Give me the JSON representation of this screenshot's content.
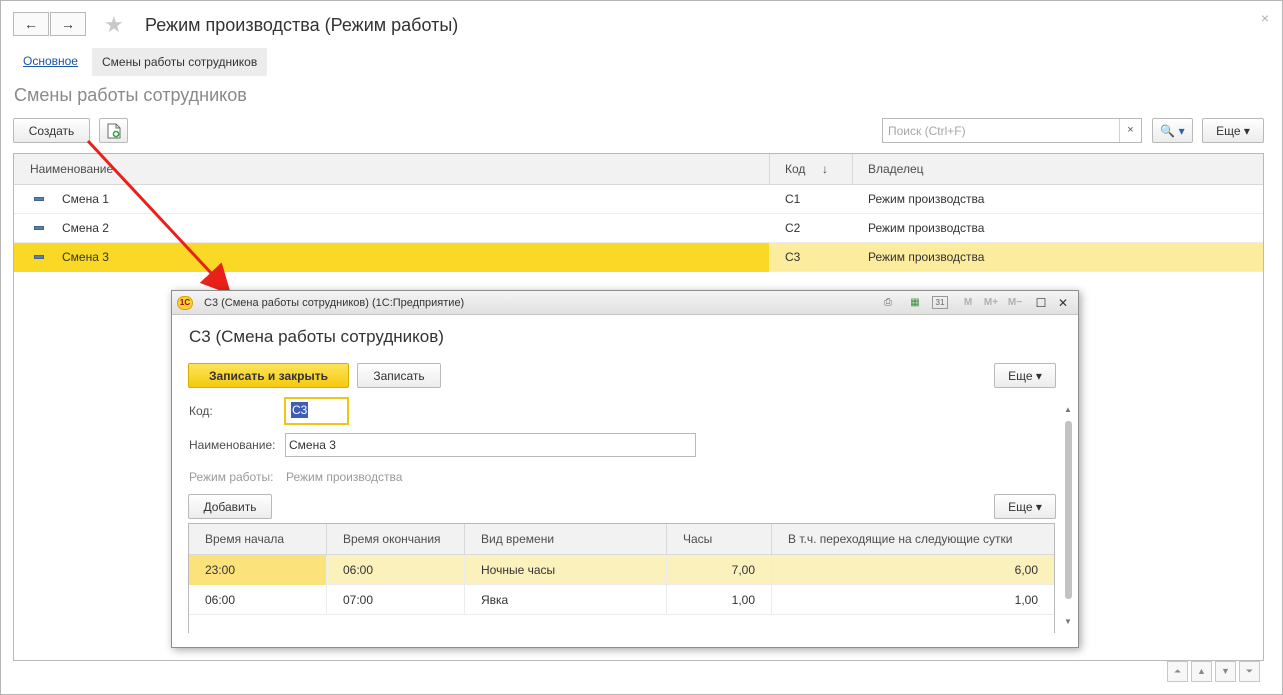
{
  "window": {
    "title": "Режим производства (Режим работы)",
    "back_glyph": "←",
    "forward_glyph": "→",
    "star_glyph": "★",
    "close_glyph": "×"
  },
  "tabs": {
    "main": "Основное",
    "shifts": "Смены работы сотрудников"
  },
  "list": {
    "title": "Смены работы сотрудников",
    "create_label": "Создать",
    "search_placeholder": "Поиск (Ctrl+F)",
    "search_clear": "×",
    "search_btn": "🔍 ▾",
    "more_label": "Еще ▾",
    "columns": {
      "name": "Наименование",
      "code": "Код",
      "code_sort": "↓",
      "owner": "Владелец"
    },
    "rows": [
      {
        "name": "Смена 1",
        "code": "С1",
        "owner": "Режим производства"
      },
      {
        "name": "Смена 2",
        "code": "С2",
        "owner": "Режим производства"
      },
      {
        "name": "Смена 3",
        "code": "С3",
        "owner": "Режим производства"
      }
    ],
    "pager": [
      "⏶",
      "▲",
      "▼",
      "⏷"
    ]
  },
  "dialog": {
    "titlebar": "С3 (Смена работы сотрудников)  (1С:Предприятие)",
    "logo": "1С",
    "controls": {
      "print": "⎙",
      "calc": "▦",
      "calendar": "31",
      "m": "M",
      "mplus": "M+",
      "mminus": "M−",
      "maximize": "☐",
      "close": "✕"
    },
    "heading": "С3 (Смена работы сотрудников)",
    "save_close_label": "Записать и закрыть",
    "save_label": "Записать",
    "more_label": "Еще ▾",
    "fields": {
      "code_label": "Код:",
      "code_value": "С3",
      "name_label": "Наименование:",
      "name_value": "Смена 3",
      "mode_label": "Режим работы:",
      "mode_value": "Режим производства"
    },
    "add_label": "Добавить",
    "table_more_label": "Еще ▾",
    "table": {
      "headers": [
        "Время начала",
        "Время окончания",
        "Вид времени",
        "Часы",
        "В т.ч. переходящие на следующие сутки"
      ],
      "rows": [
        [
          "23:00",
          "06:00",
          "Ночные часы",
          "7,00",
          "6,00"
        ],
        [
          "06:00",
          "07:00",
          "Явка",
          "1,00",
          "1,00"
        ]
      ]
    }
  }
}
